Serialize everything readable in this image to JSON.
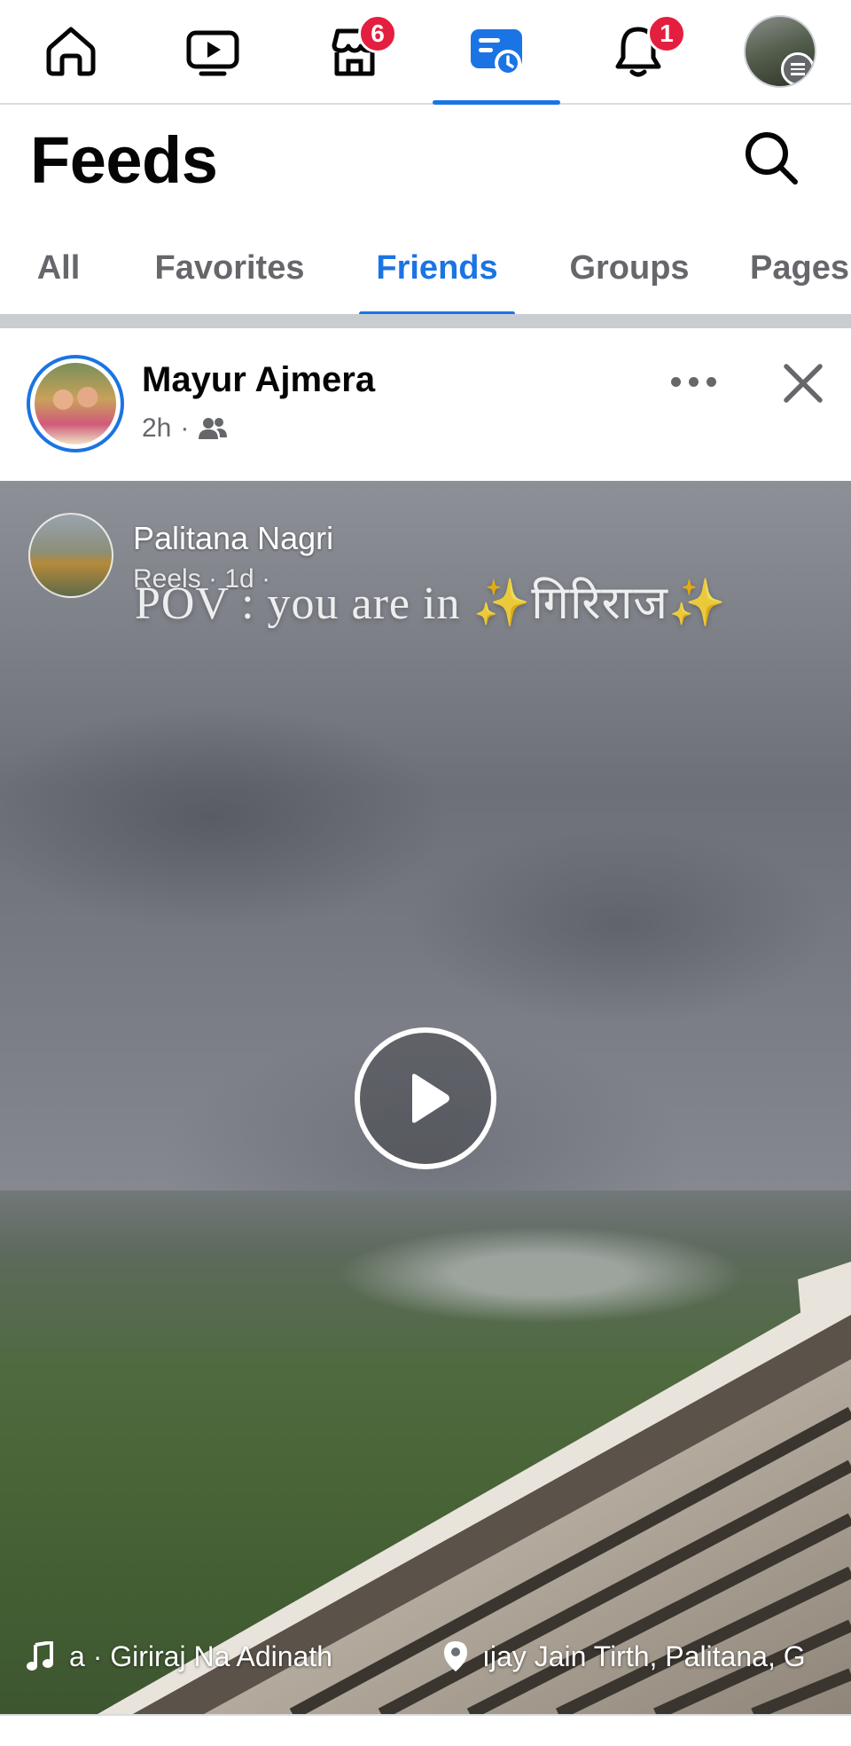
{
  "nav": {
    "items": [
      {
        "name": "home",
        "icon": "home-icon",
        "badge": ""
      },
      {
        "name": "video",
        "icon": "video-icon",
        "badge": ""
      },
      {
        "name": "marketplace",
        "icon": "marketplace-icon",
        "badge": "6"
      },
      {
        "name": "feeds",
        "icon": "feeds-icon",
        "badge": "",
        "active": true
      },
      {
        "name": "notifications",
        "icon": "bell-icon",
        "badge": "1"
      },
      {
        "name": "profile-menu",
        "icon": "profile-avatar",
        "badge": ""
      }
    ],
    "accent_color": "#1b74e4",
    "badge_color": "#e41e3f"
  },
  "header": {
    "title": "Feeds",
    "search_icon": "search-icon"
  },
  "tabs": {
    "items": [
      "All",
      "Favorites",
      "Friends",
      "Groups",
      "Pages"
    ],
    "active": "Friends"
  },
  "post": {
    "author": "Mayur Ajmera",
    "time": "2h",
    "separator": "·",
    "audience_icon": "friends-icon",
    "more_icon": "more-dots-icon",
    "close_icon": "close-icon",
    "reel": {
      "page_name": "Palitana Nagri",
      "page_meta": "Reels · 1d ·",
      "caption": "POV : you are in ✨गिरिराज✨",
      "play_icon": "play-icon",
      "audio": "a · Giriraj Na Adinath",
      "audio_icon": "music-note-icon",
      "location": "ıjay Jain Tirth, Palitana, G",
      "location_icon": "location-pin-icon"
    }
  }
}
